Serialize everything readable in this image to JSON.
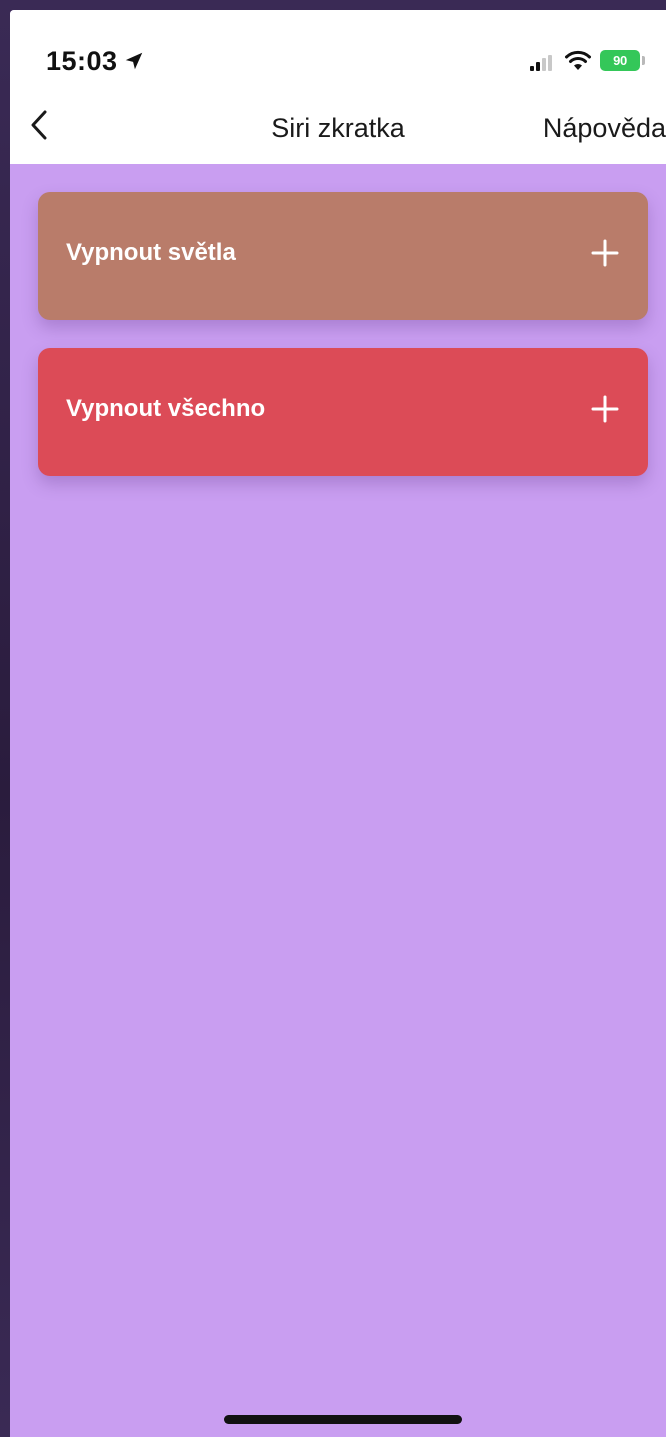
{
  "status_bar": {
    "time": "15:03",
    "location_icon": "location-arrow-icon",
    "signal_icon": "cellular-signal-icon",
    "wifi_icon": "wifi-icon",
    "battery_level": "90",
    "battery_color": "#34c759"
  },
  "nav": {
    "back_icon": "chevron-left-icon",
    "title": "Siri zkratka",
    "help_label": "Nápověda"
  },
  "shortcuts": [
    {
      "label": "Vypnout světla",
      "color": "#b97c6a",
      "action_icon": "plus-icon"
    },
    {
      "label": "Vypnout všechno",
      "color": "#dc4b57",
      "action_icon": "plus-icon"
    }
  ],
  "theme": {
    "background": "#c99ef1",
    "header_background": "#ffffff"
  }
}
